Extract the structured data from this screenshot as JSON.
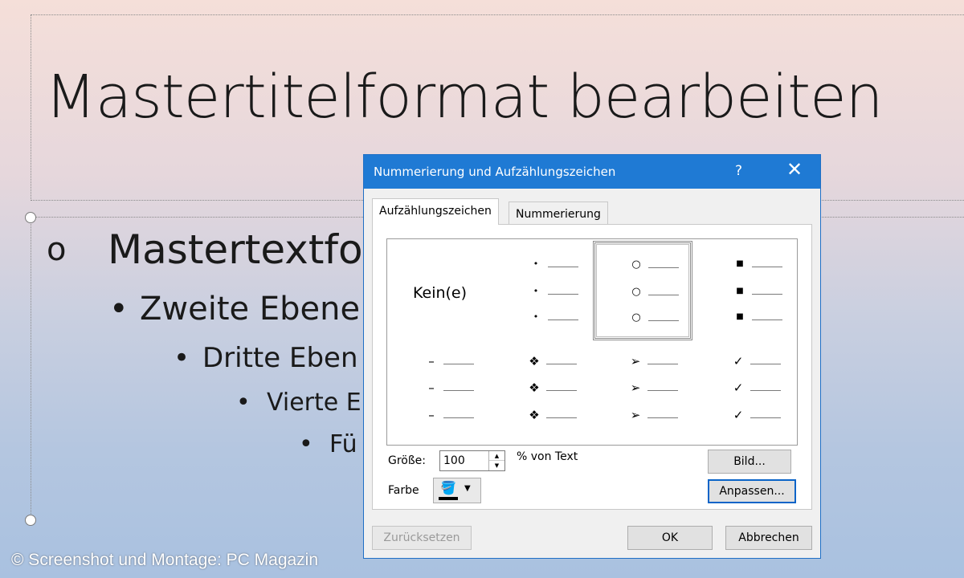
{
  "slide": {
    "title": "Mastertitelformat bearbeiten",
    "levels": [
      {
        "bullet": "o",
        "text": "Mastertextfo"
      },
      {
        "bullet": "•",
        "text": "Zweite Ebene"
      },
      {
        "bullet": "•",
        "text": "Dritte Eben"
      },
      {
        "bullet": "•",
        "text": "Vierte E"
      },
      {
        "bullet": "•",
        "text": "Fü"
      }
    ]
  },
  "credit": "© Screenshot und Montage: PC Magazin",
  "dialog": {
    "title": "Nummerierung und Aufzählungszeichen",
    "help": "?",
    "close": "✕",
    "tabs": {
      "bullets": "Aufzählungszeichen",
      "numbering": "Nummerierung"
    },
    "none_label": "Kein(e)",
    "bullet_styles": [
      {
        "name": "none"
      },
      {
        "name": "small-dot",
        "symbol": "•"
      },
      {
        "name": "hollow-circle",
        "symbol": "○",
        "selected": true
      },
      {
        "name": "square",
        "symbol": "■"
      },
      {
        "name": "dash",
        "symbol": "–"
      },
      {
        "name": "diamond-cross",
        "symbol": "❖"
      },
      {
        "name": "arrow",
        "symbol": "➢"
      },
      {
        "name": "checkmark",
        "symbol": "✓"
      }
    ],
    "size_label": "Größe:",
    "size_value": "100",
    "size_unit": "% von Text",
    "color_label": "Farbe",
    "color_value": "#000000",
    "buttons": {
      "picture": "Bild...",
      "customize": "Anpassen...",
      "reset": "Zurücksetzen",
      "ok": "OK",
      "cancel": "Abbrechen"
    }
  },
  "colors": {
    "titlebar": "#1f7ad4",
    "selection_border": "#8c8c8c"
  }
}
